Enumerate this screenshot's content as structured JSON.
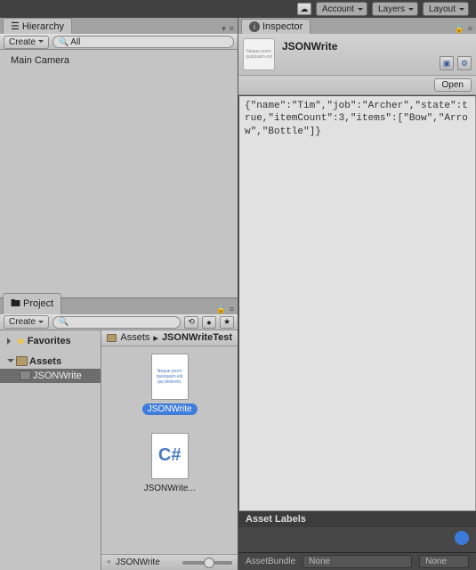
{
  "toolbar": {
    "account": "Account",
    "layers": "Layers",
    "layout": "Layout"
  },
  "hierarchy": {
    "tab": "Hierarchy",
    "create": "Create",
    "searchPrefix": "All",
    "items": [
      "Main Camera"
    ]
  },
  "project": {
    "tab": "Project",
    "create": "Create",
    "favorites": "Favorites",
    "assets": "Assets",
    "subfolder": "JSONWrite",
    "crumbs": [
      "Assets",
      "JSONWriteTest"
    ],
    "files": [
      {
        "name": "JSONWrite",
        "type": "text",
        "selected": true,
        "preview": "Neque porro quisquam est qui dolorem."
      },
      {
        "name": "JSONWrite...",
        "type": "cs",
        "selected": false,
        "preview": "C#"
      }
    ],
    "footer": "JSONWrite"
  },
  "inspector": {
    "tab": "Inspector",
    "assetName": "JSONWrite",
    "open": "Open",
    "content": "{\"name\":\"Tim\",\"job\":\"Archer\",\"state\":true,\"itemCount\":3,\"items\":[\"Bow\",\"Arrow\",\"Bottle\"]}",
    "assetLabels": "Asset Labels",
    "assetBundle": "AssetBundle",
    "none": "None"
  }
}
